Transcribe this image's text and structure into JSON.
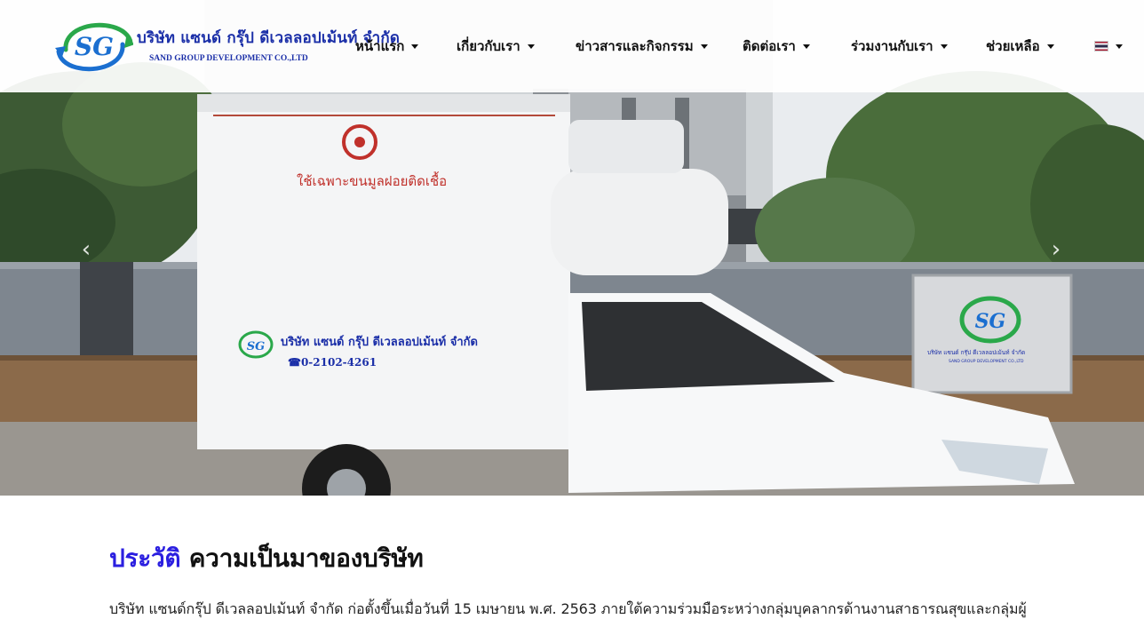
{
  "colors": {
    "brand_blue": "#1b2fa8",
    "accent_blue": "#2b1fe0",
    "logo_green": "#2aa84a",
    "nav_text": "#111111"
  },
  "brand": {
    "name_th": "บริษัท แซนด์ กรุ๊ป ดีเวลลอปเม้นท์ จำกัด",
    "name_en": "SAND GROUP DEVELOPMENT CO.,LTD",
    "logo_text": "SG"
  },
  "nav": {
    "items": [
      {
        "label": "หน้าแรก",
        "icon": "chevron-down-icon"
      },
      {
        "label": "เกี่ยวกับเรา",
        "icon": "chevron-down-icon"
      },
      {
        "label": "ข่าวสารและกิจกรรม",
        "icon": "chevron-down-icon"
      },
      {
        "label": "ติดต่อเรา",
        "icon": "chevron-down-icon"
      },
      {
        "label": "ร่วมงานกับเรา",
        "icon": "chevron-down-icon"
      },
      {
        "label": "ช่วยเหลือ",
        "icon": "chevron-down-icon"
      }
    ],
    "language_icon": "thai-flag-icon"
  },
  "carousel": {
    "prev_icon": "chevron-left-icon",
    "next_icon": "chevron-right-icon",
    "truck_warning": "ใช้เฉพาะขนมูลฝอยติดเชื้อ",
    "truck_company": "บริษัท แซนด์ กรุ๊ป ดีเวลลอปเม้นท์ จำกัด",
    "truck_phone": "0-2102-4261",
    "sign_company": "บริษัท แซนด์ กรุ๊ป ดีเวลลอปเม้นท์ จำกัด",
    "sign_company_en": "SAND GROUP DEVELOPMENT CO.,LTD"
  },
  "history": {
    "title_accent": "ประวัติ",
    "title_rest": " ความเป็นมาของบริษัท",
    "intro": "บริษัท แซนด์กรุ๊ป ดีเวลลอปเม้นท์ จำกัด ก่อตั้งขึ้นเมื่อวันที่ 15 เมษายน พ.ศ. 2563 ภายใต้ความร่วมมือระหว่างกลุ่มบุคลากรด้านงานสาธารณสุขและกลุ่มผู้"
  }
}
